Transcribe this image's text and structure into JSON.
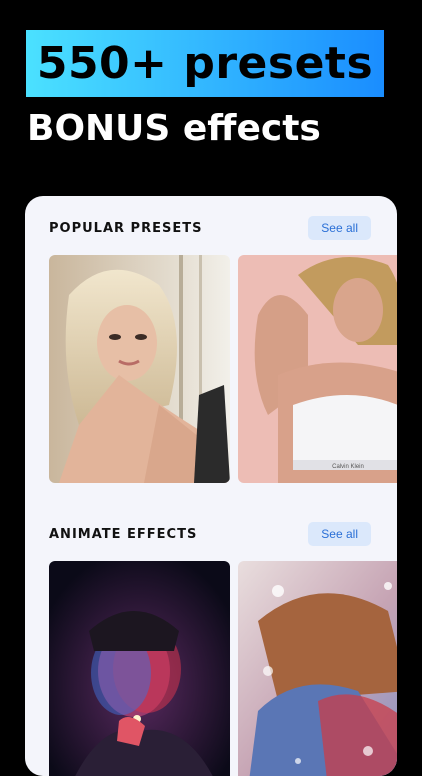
{
  "headline": "550+ presets",
  "subheadline": "BONUS effects",
  "sections": [
    {
      "title": "POPULAR PRESETS",
      "see_all": "See all",
      "items": [
        {
          "thumb": "woman-blonde-portrait"
        },
        {
          "thumb": "woman-sports-bra-pink-background",
          "bra_text": "Calvin Klein"
        }
      ]
    },
    {
      "title": "ANIMATE EFFECTS",
      "see_all": "See all",
      "items": [
        {
          "thumb": "man-lighting-cigarette-neon"
        },
        {
          "thumb": "couple-embrace-snow-effect"
        }
      ]
    }
  ]
}
